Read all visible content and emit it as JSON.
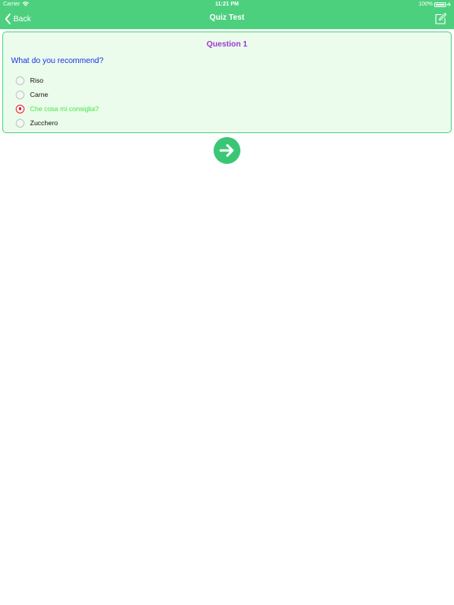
{
  "status_bar": {
    "carrier": "Carrier",
    "time": "11:21 PM",
    "battery": "100%",
    "battery_level": 1.0
  },
  "nav": {
    "back_label": "Back",
    "title": "Quiz Test"
  },
  "question": {
    "number_label": "Question 1",
    "text": "What do you recommend?",
    "options": [
      {
        "label": "Riso",
        "selected": false
      },
      {
        "label": "Carne",
        "selected": false
      },
      {
        "label": "Che cosa mi consiglia?",
        "selected": true
      },
      {
        "label": "Zucchero",
        "selected": false
      }
    ]
  },
  "colors": {
    "accent": "#4cd07e",
    "card_background": "#ecfcec",
    "question_number": "#9b3ad6",
    "question_text": "#1a2ee8",
    "selected_radio": "#e81c1c",
    "selected_text": "#3ee83e",
    "next_button": "#39c775"
  },
  "icons": {
    "back": "chevron-left-icon",
    "edit": "edit-icon",
    "next": "arrow-right-icon",
    "wifi": "wifi-icon",
    "battery": "battery-icon"
  }
}
